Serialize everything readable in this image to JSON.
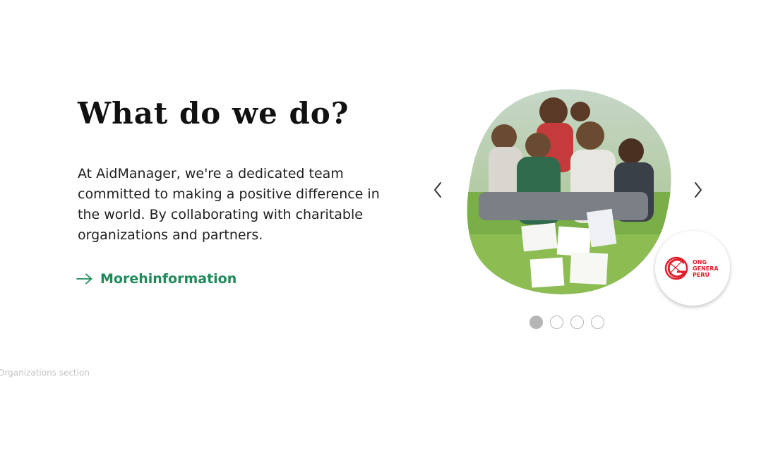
{
  "heading": "What do we do?",
  "description": "At AidManager, we're a dedicated team committed to making a positive difference in the world. By collaborating with charitable organizations and partners.",
  "more_link": {
    "label": "Morehinformation",
    "icon": "arrow-right-icon"
  },
  "carousel": {
    "prev_icon": "chevron-left-icon",
    "next_icon": "chevron-right-icon",
    "slide_image": "children-group-photo",
    "partner_logo": {
      "lines": [
        "ONG",
        "GENERA",
        "PERÚ"
      ],
      "color": "#e0202a"
    },
    "indicators": {
      "count": 4,
      "active": 1
    }
  },
  "section_label": "Organizations section",
  "colors": {
    "accent": "#1f8a5a",
    "logo_red": "#e0202a",
    "dot": "#b5b5b5"
  }
}
